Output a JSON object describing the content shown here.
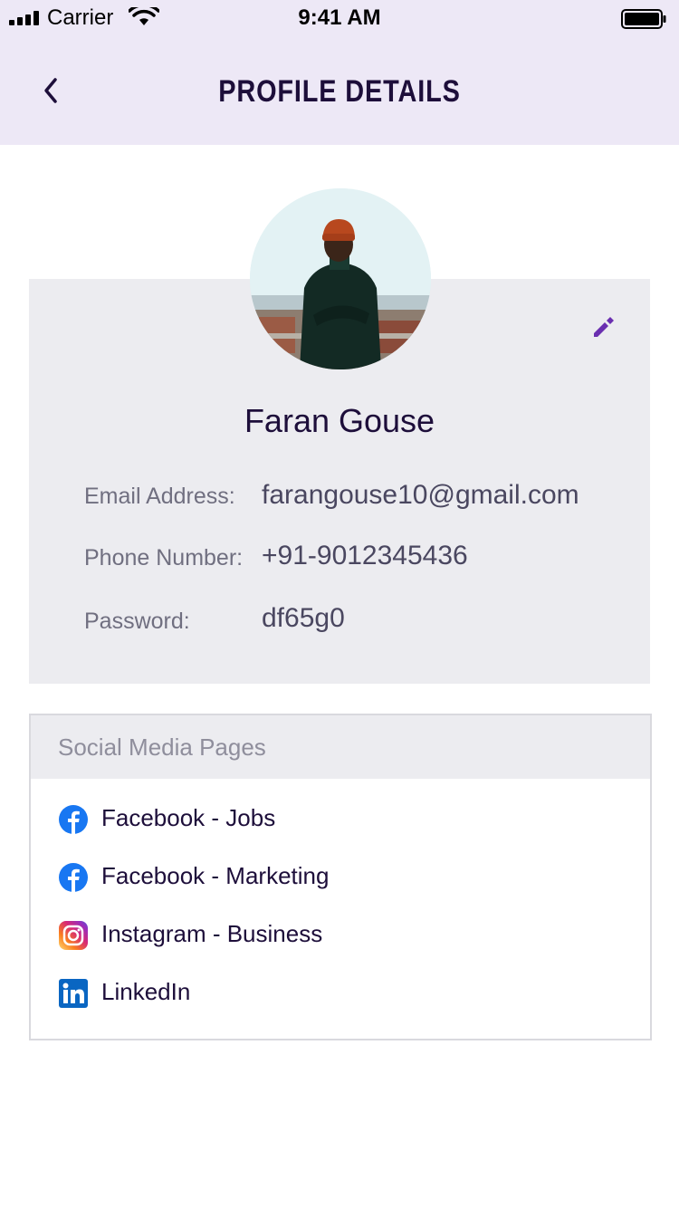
{
  "status_bar": {
    "carrier": "Carrier",
    "time": "9:41 AM"
  },
  "header": {
    "title": "PROFILE DETAILS",
    "back_icon": "chevron-left-icon"
  },
  "profile": {
    "name": "Faran Gouse",
    "edit_icon": "pencil-icon",
    "fields": [
      {
        "label": "Email Address:",
        "value": "farangouse10@gmail.com"
      },
      {
        "label": "Phone Number:",
        "value": "+91-9012345436"
      },
      {
        "label": "Password:",
        "value": "df65g0"
      }
    ]
  },
  "social": {
    "title": "Social Media Pages",
    "items": [
      {
        "label": "Facebook - Jobs",
        "icon": "facebook-icon"
      },
      {
        "label": "Facebook - Marketing",
        "icon": "facebook-icon"
      },
      {
        "label": "Instagram - Business",
        "icon": "instagram-icon"
      },
      {
        "label": "LinkedIn",
        "icon": "linkedin-icon"
      }
    ]
  },
  "colors": {
    "header_bg": "#ede8f6",
    "card_bg": "#ececf0",
    "text_dark": "#1d0e3a",
    "accent": "#6a2fb0",
    "facebook": "#1877f2",
    "linkedin": "#0a66c2"
  }
}
